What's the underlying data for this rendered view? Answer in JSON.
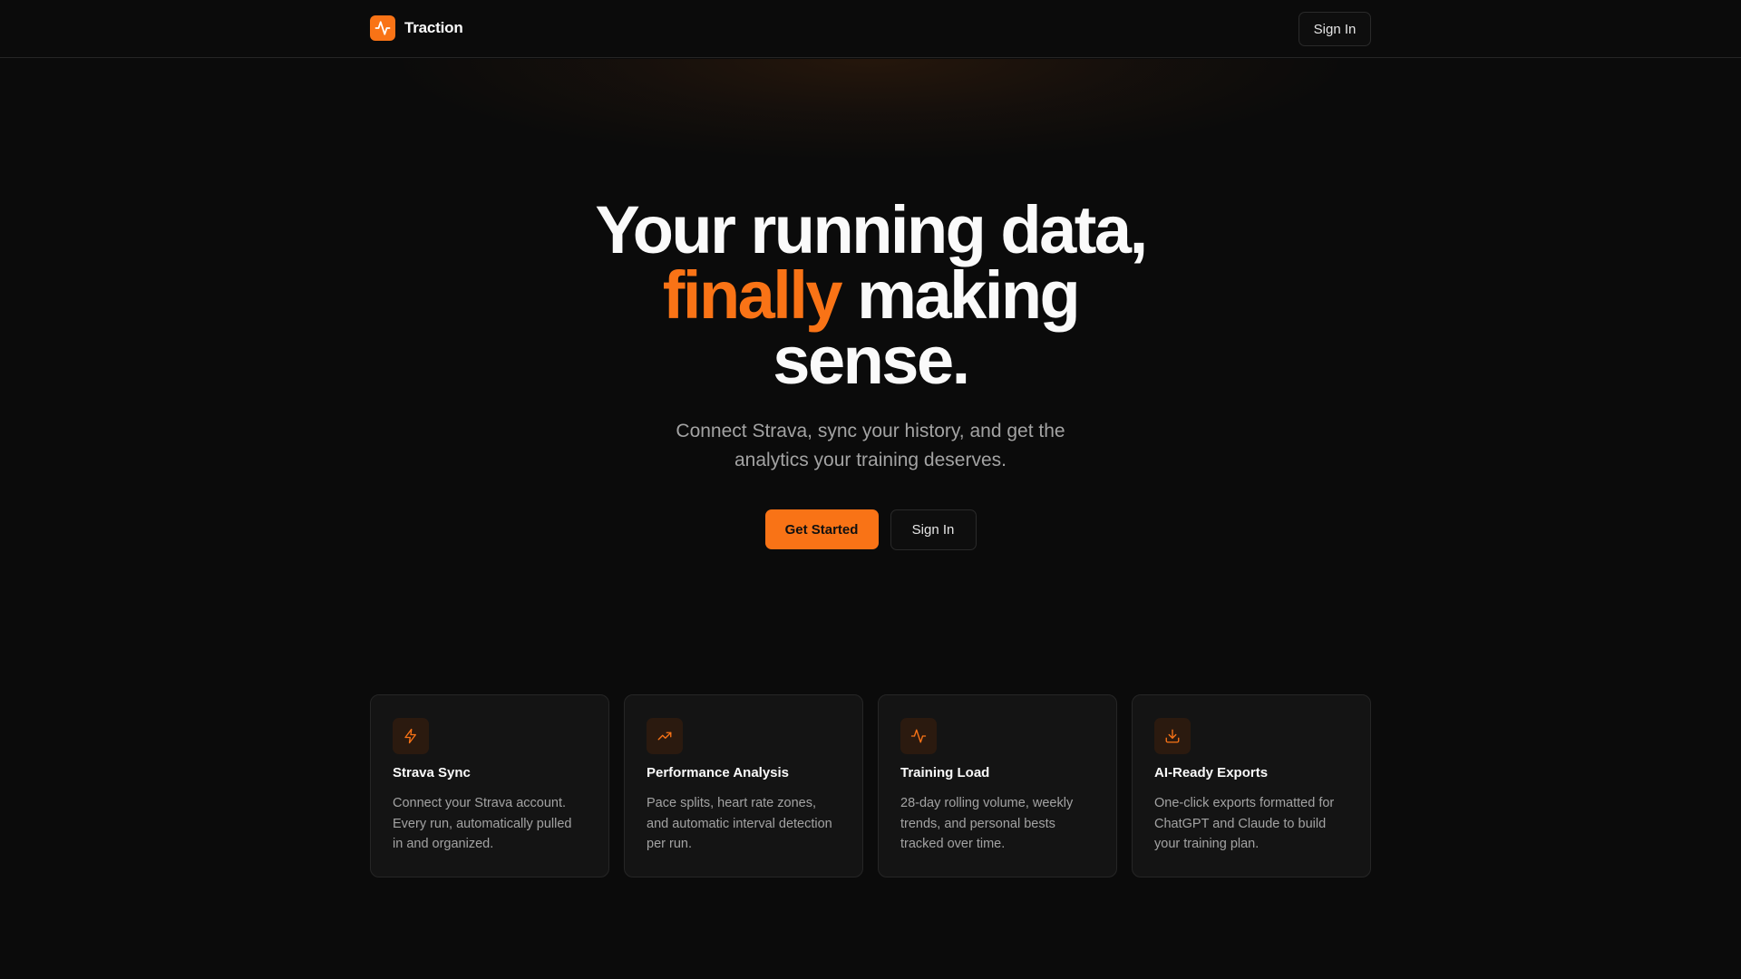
{
  "brand": {
    "name": "Traction",
    "accent_color": "#f97316",
    "logo_icon": "activity-pulse-icon"
  },
  "nav": {
    "signin_label": "Sign In"
  },
  "hero": {
    "headline_line1": "Your running data,",
    "headline_accent": "finally",
    "headline_line2_rest": " making",
    "headline_line3": "sense.",
    "subtitle_line1": "Connect Strava, sync your history, and get the",
    "subtitle_line2": "analytics your training deserves.",
    "primary_cta_label": "Get Started",
    "secondary_cta_label": "Sign In"
  },
  "features": [
    {
      "icon": "lightning-bolt-icon",
      "title": "Strava Sync",
      "line1": "Connect your Strava account.",
      "line2": "Every run, automatically pulled",
      "line3": "in and organized."
    },
    {
      "icon": "trending-up-icon",
      "title": "Performance Analysis",
      "line1": "Pace splits, heart rate zones,",
      "line2": "and automatic interval detection",
      "line3": "per run."
    },
    {
      "icon": "activity-pulse-icon",
      "title": "Training Load",
      "line1": "28-day rolling volume, weekly",
      "line2": "trends, and personal bests",
      "line3": "tracked over time."
    },
    {
      "icon": "download-icon",
      "title": "AI-Ready Exports",
      "line1": "One-click exports formatted for",
      "line2": "ChatGPT and Claude to build",
      "line3": "your training plan."
    }
  ]
}
